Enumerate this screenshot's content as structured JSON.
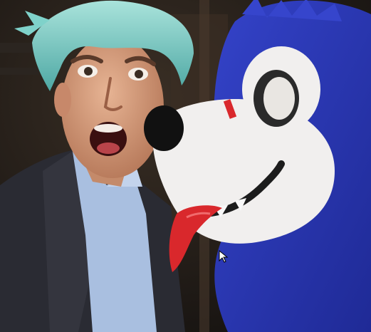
{
  "photo": {
    "kind": "selfie-photo",
    "palette": {
      "background": "#221c16",
      "door_panel": "#3a2e24",
      "hair": "#6fc6c0",
      "skin": "#d9a07e",
      "suit": "#2a2b33",
      "shirt": "#a9bfe0",
      "costume_blue": "#2a39b8",
      "costume_white": "#f1efee",
      "tongue": "#d9282c",
      "nose": "#111111"
    },
    "cursor_icon": "mouse-pointer-icon"
  }
}
